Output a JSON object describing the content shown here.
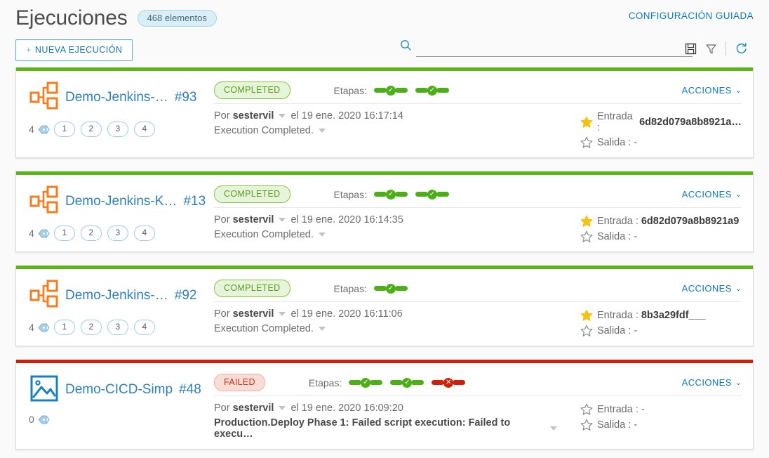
{
  "header": {
    "title": "Ejecuciones",
    "count_badge": "468 elementos",
    "guided_config_link": "CONFIGURACIÓN GUIADA",
    "new_execution_button": "+ NUEVA EJECUCIÓN",
    "new_execution_plus": "+",
    "new_execution_label": "NUEVA EJECUCIÓN",
    "search_value": "",
    "search_placeholder": "",
    "icons": [
      "search-icon",
      "save-icon",
      "filter-icon",
      "refresh-icon"
    ]
  },
  "labels": {
    "stages": "Etapas:",
    "by": "Por",
    "actions": "ACCIONES",
    "input": "Entrada :",
    "output": "Salida :",
    "dash": "-"
  },
  "colors": {
    "accent_blue": "#0a7ac4",
    "status_green": "#5cb418",
    "status_red": "#c9210a",
    "icon_orange": "#f57c1f",
    "star_yellow": "#f5c211"
  },
  "cards": [
    {
      "top_color": "#5cb418",
      "icon": "sitemap-icon",
      "name": "Demo-Jenkins-…",
      "number": "#93",
      "status": "COMPLETED",
      "status_kind": "completed",
      "stages": [
        "ok",
        "ok"
      ],
      "user": "sestervil",
      "date": "el 19 ene. 2020 16:17:14",
      "message": "Execution Completed.",
      "message_bold": false,
      "tag_count": "4",
      "tags": [
        "1",
        "2",
        "3",
        "4"
      ],
      "actions": "ACCIONES",
      "input_starred": true,
      "input_value": "6d82d079a8b8921a…",
      "output_starred": false,
      "output_value": "-"
    },
    {
      "top_color": "#5cb418",
      "icon": "sitemap-icon",
      "name": "Demo-Jenkins-K…",
      "number": "#13",
      "status": "COMPLETED",
      "status_kind": "completed",
      "stages": [
        "ok",
        "ok"
      ],
      "user": "sestervil",
      "date": "el 19 ene. 2020 16:14:35",
      "message": "Execution Completed.",
      "message_bold": false,
      "tag_count": "4",
      "tags": [
        "1",
        "2",
        "3",
        "4"
      ],
      "actions": "ACCIONES",
      "input_starred": true,
      "input_value": "6d82d079a8b8921a9",
      "output_starred": false,
      "output_value": "-"
    },
    {
      "top_color": "#5cb418",
      "icon": "sitemap-icon",
      "name": "Demo-Jenkins-…",
      "number": "#92",
      "status": "COMPLETED",
      "status_kind": "completed",
      "stages": [
        "ok"
      ],
      "user": "sestervil",
      "date": "el 19 ene. 2020 16:11:06",
      "message": "Execution Completed.",
      "message_bold": false,
      "tag_count": "4",
      "tags": [
        "1",
        "2",
        "3",
        "4"
      ],
      "actions": "ACCIONES",
      "input_starred": true,
      "input_value": "8b3a29fdf___",
      "output_starred": false,
      "output_value": "-"
    },
    {
      "top_color": "#c9210a",
      "icon": "image-icon",
      "name": "Demo-CICD-Simp",
      "number": "#48",
      "status": "FAILED",
      "status_kind": "failed",
      "stages": [
        "ok",
        "ok",
        "fail"
      ],
      "user": "sestervil",
      "date": "el 19 ene. 2020 16:09:20",
      "message": "Production.Deploy Phase 1: Failed script execution: Failed to execu…",
      "message_bold": true,
      "tag_count": "0",
      "tags": [],
      "actions": "ACCIONES",
      "input_starred": false,
      "input_value": "-",
      "output_starred": false,
      "output_value": "-"
    }
  ]
}
